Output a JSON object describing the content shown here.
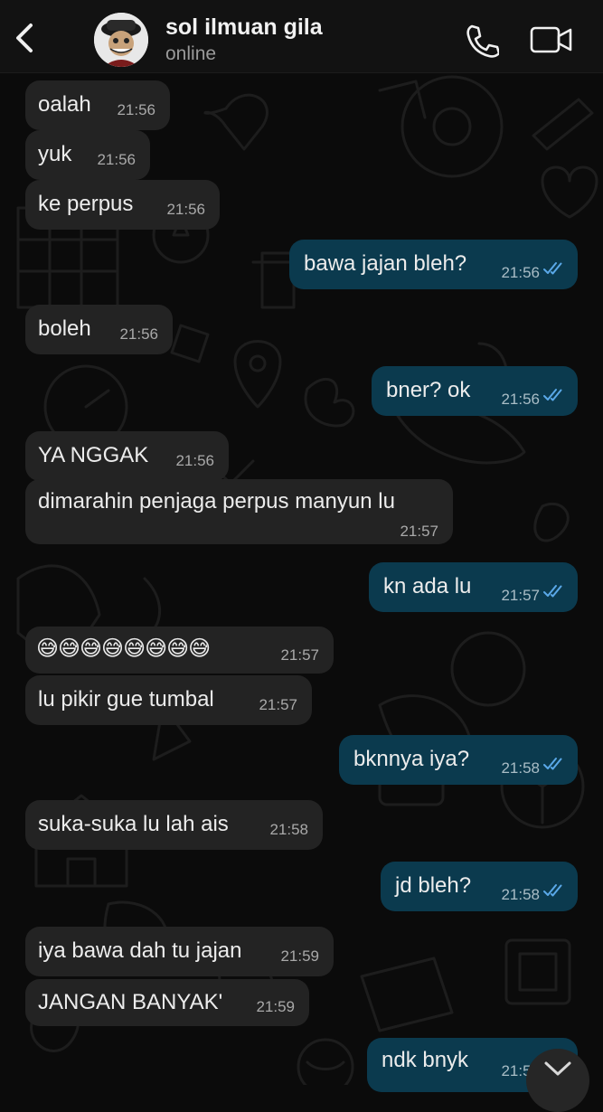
{
  "header": {
    "contact_name": "sol ilmuan gila",
    "status": "online",
    "back_icon": "chevron-left-icon",
    "call_icon": "phone-icon",
    "video_icon": "video-camera-icon"
  },
  "colors": {
    "incoming_bubble": "#232323",
    "outgoing_bubble": "#0b3a4e",
    "read_ticks": "#5aa8e8",
    "background": "#0b0b0b"
  },
  "messages": [
    {
      "dir": "in",
      "text": "oalah",
      "time": "21:56"
    },
    {
      "dir": "in",
      "text": "yuk",
      "time": "21:56"
    },
    {
      "dir": "in",
      "text": "ke perpus",
      "time": "21:56"
    },
    {
      "dir": "out",
      "text": "bawa jajan bleh?",
      "time": "21:56",
      "status": "read"
    },
    {
      "dir": "in",
      "text": "boleh",
      "time": "21:56"
    },
    {
      "dir": "out",
      "text": "bner? ok",
      "time": "21:56",
      "status": "read"
    },
    {
      "dir": "in",
      "text": "YA NGGAK",
      "time": "21:56"
    },
    {
      "dir": "in",
      "text": "dimarahin penjaga perpus manyun lu",
      "time": "21:57"
    },
    {
      "dir": "out",
      "text": "kn ada lu",
      "time": "21:57",
      "status": "read"
    },
    {
      "dir": "in",
      "text": "😅😅😅😅😅😅😅😅",
      "time": "21:57"
    },
    {
      "dir": "in",
      "text": "lu pikir gue tumbal",
      "time": "21:57"
    },
    {
      "dir": "out",
      "text": "bknnya iya?",
      "time": "21:58",
      "status": "read"
    },
    {
      "dir": "in",
      "text": "suka-suka lu lah ais",
      "time": "21:58"
    },
    {
      "dir": "out",
      "text": "jd bleh?",
      "time": "21:58",
      "status": "read"
    },
    {
      "dir": "in",
      "text": "iya bawa dah tu jajan",
      "time": "21:59"
    },
    {
      "dir": "in",
      "text": "JANGAN BANYAK'",
      "time": "21:59"
    },
    {
      "dir": "out",
      "text": "ndk bnyk",
      "time": "21:59",
      "status": "read"
    }
  ]
}
